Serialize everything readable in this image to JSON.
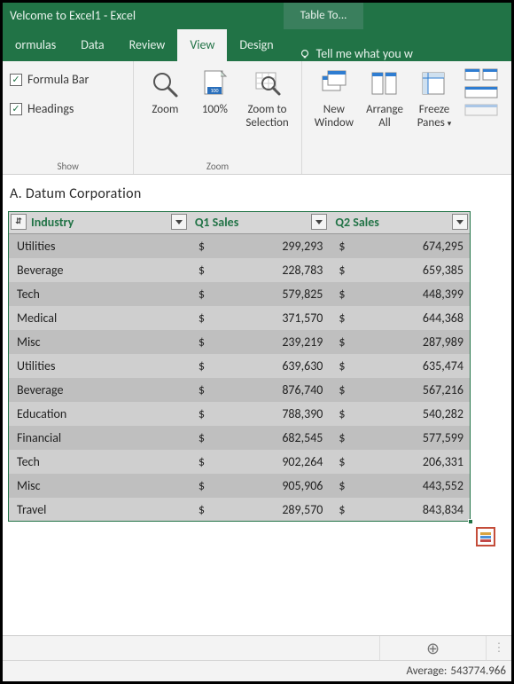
{
  "titlebar": {
    "title": "Velcome to Excel1 - Excel",
    "contextual": "Table To..."
  },
  "tabs": {
    "items": [
      "ormulas",
      "Data",
      "Review",
      "View",
      "Design"
    ],
    "active_index": 3,
    "tell_me": "Tell me what you w"
  },
  "ribbon": {
    "show": {
      "formula_bar": "Formula Bar",
      "headings": "Headings",
      "group_label": "Show"
    },
    "zoom": {
      "zoom": "Zoom",
      "hundred": "100%",
      "selection_l1": "Zoom to",
      "selection_l2": "Selection",
      "group_label": "Zoom"
    },
    "window": {
      "newwin_l1": "New",
      "newwin_l2": "Window",
      "arrange_l1": "Arrange",
      "arrange_l2": "All",
      "freeze_l1": "Freeze",
      "freeze_l2": "Panes"
    }
  },
  "company": "A. Datum Corporation",
  "table": {
    "headers": {
      "industry": "Industry",
      "q1": "Q1 Sales",
      "q2": "Q2 Sales"
    },
    "currency": "$",
    "rows": [
      {
        "industry": "Utilities",
        "q1": "299,293",
        "q2": "674,295"
      },
      {
        "industry": "Beverage",
        "q1": "228,783",
        "q2": "659,385"
      },
      {
        "industry": "Tech",
        "q1": "579,825",
        "q2": "448,399"
      },
      {
        "industry": "Medical",
        "q1": "371,570",
        "q2": "644,368"
      },
      {
        "industry": "Misc",
        "q1": "239,219",
        "q2": "287,989"
      },
      {
        "industry": "Utilities",
        "q1": "639,630",
        "q2": "635,474"
      },
      {
        "industry": "Beverage",
        "q1": "876,740",
        "q2": "567,216"
      },
      {
        "industry": "Education",
        "q1": "788,390",
        "q2": "540,282"
      },
      {
        "industry": "Financial",
        "q1": "682,545",
        "q2": "577,599"
      },
      {
        "industry": "Tech",
        "q1": "902,264",
        "q2": "206,331"
      },
      {
        "industry": "Misc",
        "q1": "905,906",
        "q2": "443,552"
      },
      {
        "industry": "Travel",
        "q1": "289,570",
        "q2": "843,834"
      }
    ]
  },
  "status": {
    "avg_label": "Average:",
    "avg_value": "543774.966"
  }
}
